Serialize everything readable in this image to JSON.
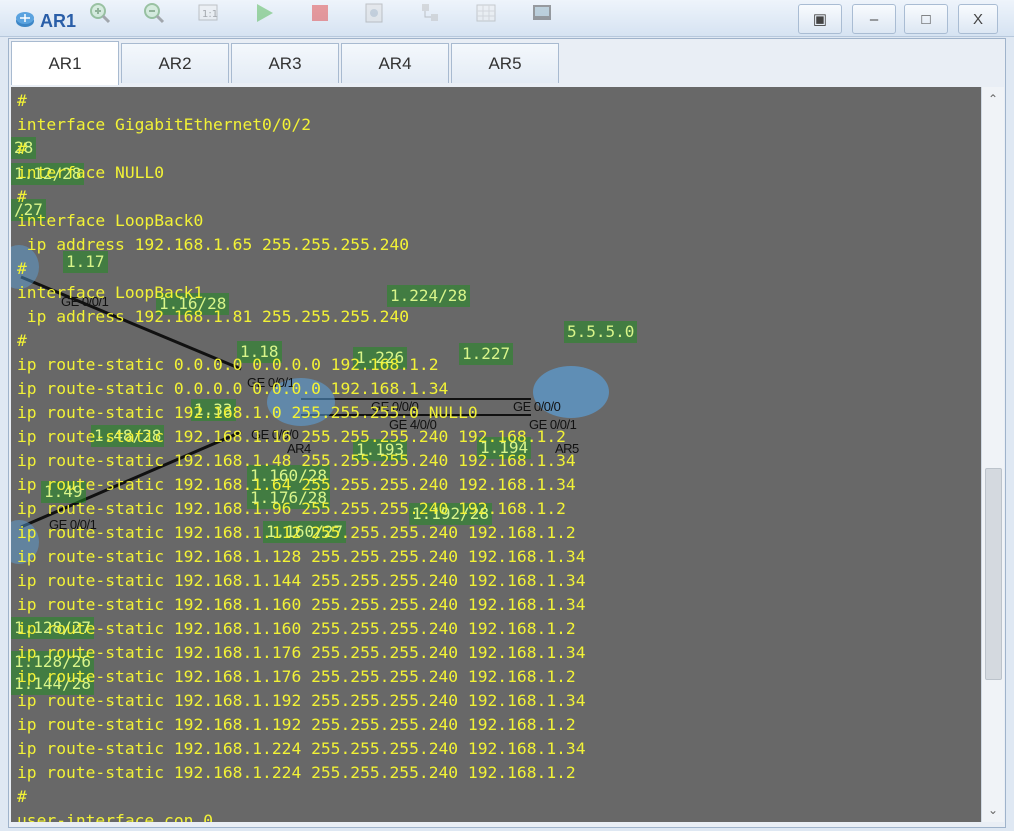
{
  "window": {
    "title": "AR1",
    "colors": {
      "console_bg": "#686868",
      "console_text": "#f2f236",
      "label_bg": "#228c22"
    }
  },
  "toolbar": {
    "icons": [
      "zoom-in-icon",
      "zoom-out-icon",
      "fit-icon",
      "start-icon",
      "stop-icon",
      "capture-icon",
      "topology-icon",
      "grid-icon",
      "terminal-icon"
    ]
  },
  "window_controls": {
    "restore": "▣",
    "minimize": "–",
    "maximize": "□",
    "close": "X"
  },
  "tabs": [
    {
      "label": "AR1",
      "active": true
    },
    {
      "label": "AR2",
      "active": false
    },
    {
      "label": "AR3",
      "active": false
    },
    {
      "label": "AR4",
      "active": false
    },
    {
      "label": "AR5",
      "active": false
    }
  ],
  "console": {
    "lines": [
      "#",
      "interface GigabitEthernet0/0/2",
      "#",
      "interface NULL0",
      "#",
      "interface LoopBack0",
      " ip address 192.168.1.65 255.255.255.240",
      "#",
      "interface LoopBack1",
      " ip address 192.168.1.81 255.255.255.240",
      "#",
      "ip route-static 0.0.0.0 0.0.0.0 192.168.1.2",
      "ip route-static 0.0.0.0 0.0.0.0 192.168.1.34",
      "ip route-static 192.168.1.0 255.255.255.0 NULL0",
      "ip route-static 192.168.1.16 255.255.255.240 192.168.1.2",
      "ip route-static 192.168.1.48 255.255.255.240 192.168.1.34",
      "ip route-static 192.168.1.64 255.255.255.240 192.168.1.34",
      "ip route-static 192.168.1.96 255.255.255.240 192.168.1.2",
      "ip route-static 192.168.1.112 255.255.255.240 192.168.1.2",
      "ip route-static 192.168.1.128 255.255.255.240 192.168.1.34",
      "ip route-static 192.168.1.144 255.255.255.240 192.168.1.34",
      "ip route-static 192.168.1.160 255.255.255.240 192.168.1.34",
      "ip route-static 192.168.1.160 255.255.255.240 192.168.1.2",
      "ip route-static 192.168.1.176 255.255.255.240 192.168.1.34",
      "ip route-static 192.168.1.176 255.255.255.240 192.168.1.2",
      "ip route-static 192.168.1.192 255.255.255.240 192.168.1.34",
      "ip route-static 192.168.1.192 255.255.255.240 192.168.1.2",
      "ip route-static 192.168.1.224 255.255.255.240 192.168.1.34",
      "ip route-static 192.168.1.224 255.255.255.240 192.168.1.2",
      "#",
      "user-interface con 0"
    ]
  },
  "topology_labels": {
    "l1": "1.17",
    "l2": "1.16/28",
    "l3": "1.224/28",
    "l4": "5.5.5.0",
    "l5": "1.18",
    "l6": "1.226",
    "l7": "1.227",
    "l8": "1.33",
    "l9": "1.48/28",
    "l10": "1.193",
    "l11": "1.194",
    "l12": "1.160/28",
    "l13": "1.176/28",
    "l14": "1.49",
    "l15": "1.192/28",
    "l16": "1.160/27",
    "l17": "1.128/27",
    "l18": "1.128/26",
    "l19": "1.144/28",
    "l20": "28",
    "l21": "/27",
    "l22": "/27",
    "l23": "1.12/28"
  },
  "topology_ports": {
    "p1": "GE 0/0/1",
    "p2": "GE 0/0/1",
    "p3": "GE 0/0/0",
    "p4": "GE 0/0/0",
    "p5": "GE 4/0/0",
    "p6": "GE 0/0/0",
    "p7": "GE 0/0/1",
    "p8": "AR4",
    "p9": "AR5",
    "p10": "GE 0/0/1"
  }
}
